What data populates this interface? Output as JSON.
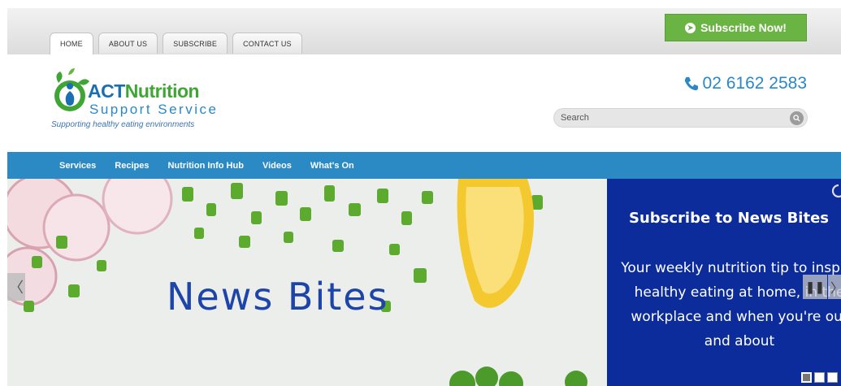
{
  "topbar": {
    "tabs": [
      {
        "label": "HOME",
        "active": true
      },
      {
        "label": "ABOUT US",
        "active": false
      },
      {
        "label": "SUBSCRIBE",
        "active": false
      },
      {
        "label": "CONTACT US",
        "active": false
      }
    ],
    "subscribe_button": "Subscribe Now!",
    "subscribe_icon": "arrow-circle-right-icon",
    "subscribe_color": "#69b442"
  },
  "header": {
    "logo_act": "ACT",
    "logo_nutrition": "Nutrition",
    "logo_support": "Support Service",
    "tagline": "Supporting healthy eating environments",
    "phone": "02 6162 2583",
    "phone_icon": "phone-icon",
    "search_placeholder": "Search",
    "search_icon": "search-icon"
  },
  "nav": {
    "color": "#2b8ac4",
    "items": [
      "Services",
      "Recipes",
      "Nutrition Info Hub",
      "Videos",
      "What's On"
    ]
  },
  "hero": {
    "slide_title": "News Bites",
    "panel_title": "Subscribe to News Bites",
    "panel_body": "Your weekly nutrition tip to inspire healthy eating at home, in the workplace and when you're out and about",
    "panel_color": "#0b2c9a",
    "prev_icon": "chevron-left-icon",
    "next_icon": "chevron-right-icon",
    "pause_icon": "pause-icon",
    "slides_count": 3,
    "active_slide": 1
  }
}
